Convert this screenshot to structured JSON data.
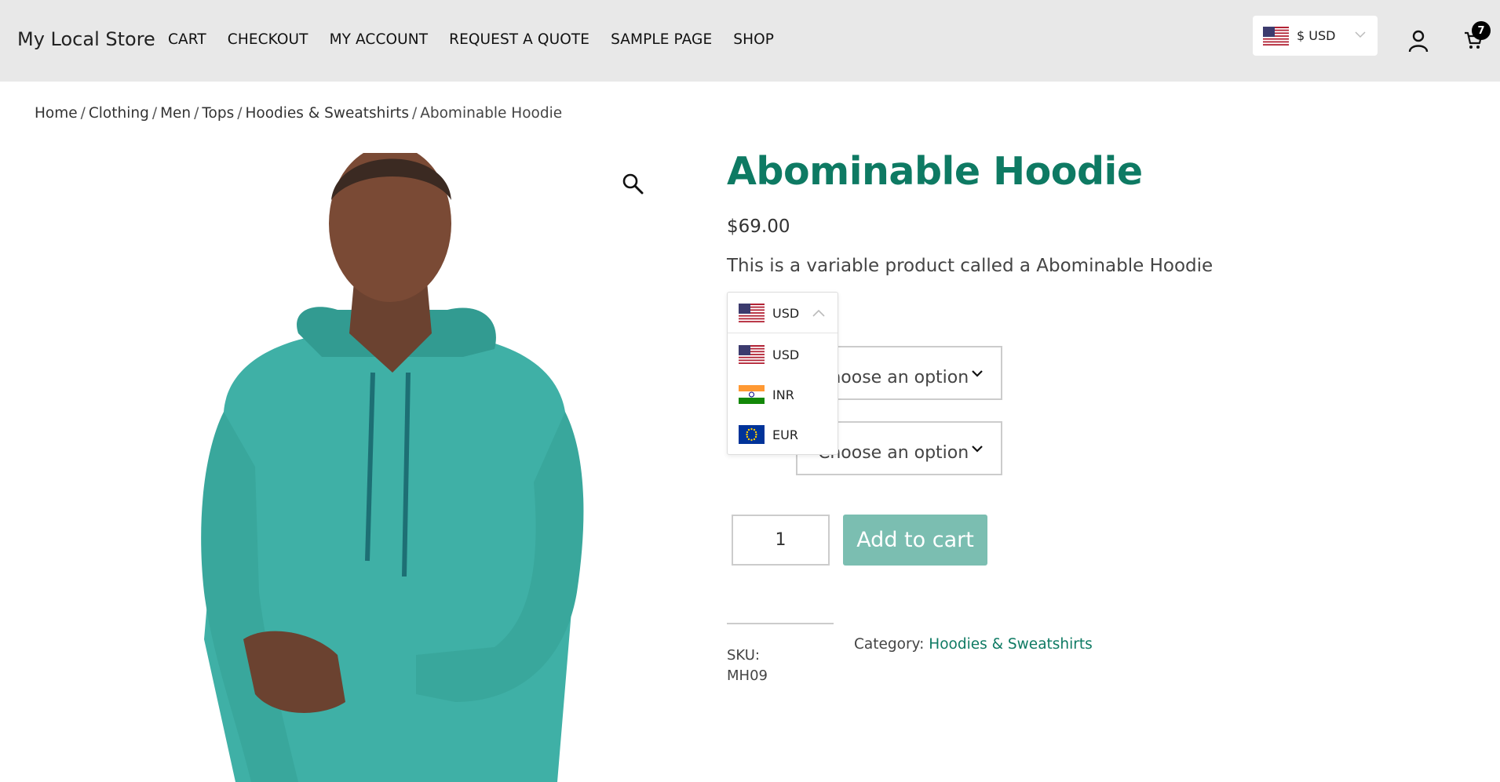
{
  "header": {
    "site_title": "My Local Store",
    "nav": [
      "CART",
      "CHECKOUT",
      "MY ACCOUNT",
      "REQUEST A QUOTE",
      "SAMPLE PAGE",
      "SHOP"
    ],
    "currency_switcher": {
      "label": "$ USD",
      "flag": "us-flag-icon"
    },
    "account_icon": "user-icon",
    "cart_icon": "cart-icon",
    "cart_count": "7"
  },
  "breadcrumb": [
    "Home",
    "Clothing",
    "Men",
    "Tops",
    "Hoodies & Sweatshirts",
    "Abominable Hoodie"
  ],
  "product": {
    "title": "Abominable Hoodie",
    "price": "$69.00",
    "description": "This is a variable product called a Abominable Hoodie",
    "select_1": "Choose an option",
    "select_2": "Choose an option",
    "quantity": "1",
    "add_to_cart": "Add to cart",
    "sku_label": "SKU:",
    "sku_value": "MH09",
    "category_label": "Category:",
    "category_link": "Hoodies & Sweatshirts"
  },
  "currency_dropdown": {
    "current": "USD",
    "options": [
      "USD",
      "INR",
      "EUR"
    ]
  },
  "colors": {
    "brand_green": "#0e7a63",
    "button_teal": "#7bbeb1",
    "header_bg": "#e8e8e8",
    "hoodie": "#3fb0a6"
  }
}
